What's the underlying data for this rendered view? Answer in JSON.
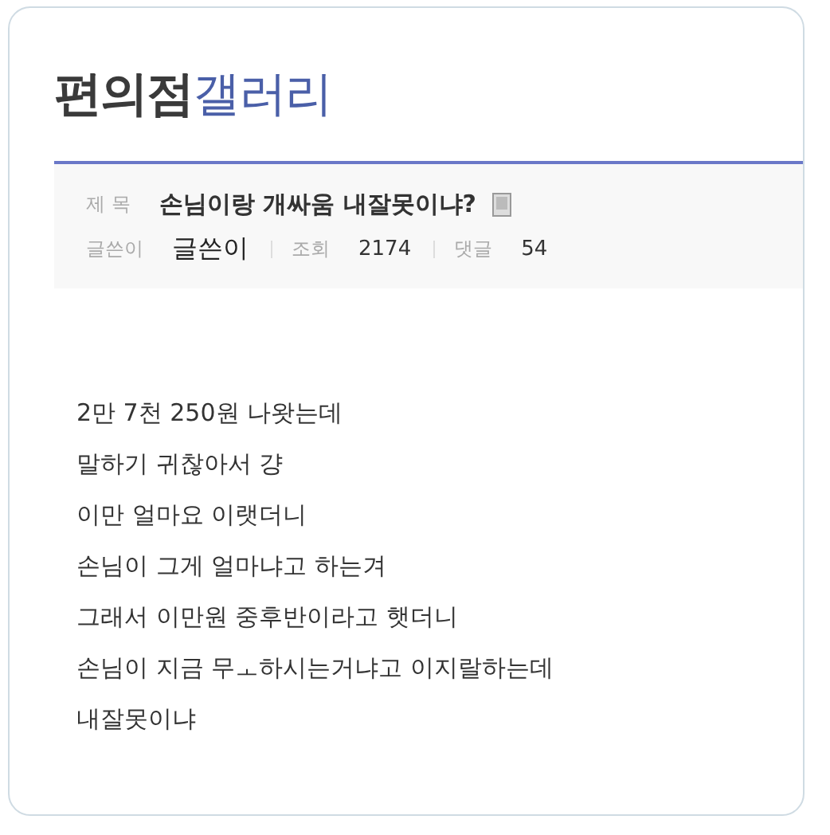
{
  "gallery_title": {
    "name": "편의점",
    "highlight": "갤러리"
  },
  "post": {
    "subject_label": "제 목",
    "subject": "손님이랑 개싸움 내잘못이냐?",
    "author_label": "글쓴이",
    "author": "글쓴이",
    "views_label": "조회",
    "views": "2174",
    "comments_label": "댓글",
    "comments": "54"
  },
  "body_lines": [
    "2만 7천 250원 나왓는데",
    "말하기 귀찮아서 걍",
    "이만 얼마요 이랫더니",
    "손님이 그게 얼마냐고 하는겨",
    "그래서 이만원 중후반이라고 햇더니",
    "손님이 지금 무ㅗ하시는거냐고 이지랄하는데",
    "내잘못이냐"
  ]
}
